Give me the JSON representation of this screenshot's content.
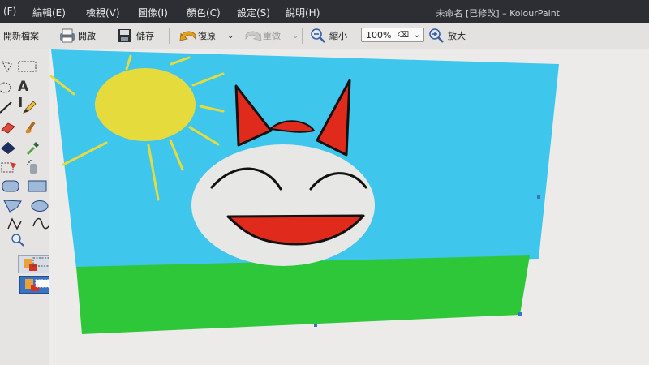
{
  "menubar": {
    "file_frag": "(F)",
    "edit": "編輯(E)",
    "view": "檢視(V)",
    "image": "圖像(I)",
    "colors": "顏色(C)",
    "settings": "設定(S)",
    "help": "說明(H)",
    "window_title": "未命名 [已修改] – KolourPaint"
  },
  "toolbar": {
    "new_label": "開新檔案",
    "open_label": "開啟",
    "save_label": "儲存",
    "undo_label": "復原",
    "redo_label": "重做",
    "zoom_out_label": "縮小",
    "zoom_value": "100%",
    "zoom_in_label": "放大"
  },
  "tools": {
    "text_tool_label": "A I"
  },
  "colors": {
    "menubar_bg": "#2c2e33",
    "sky": "#3ec6ec",
    "grass": "#2ec73a",
    "sun": "#e6db3c",
    "face": "#e7e7e6",
    "red": "#e02a1c"
  }
}
